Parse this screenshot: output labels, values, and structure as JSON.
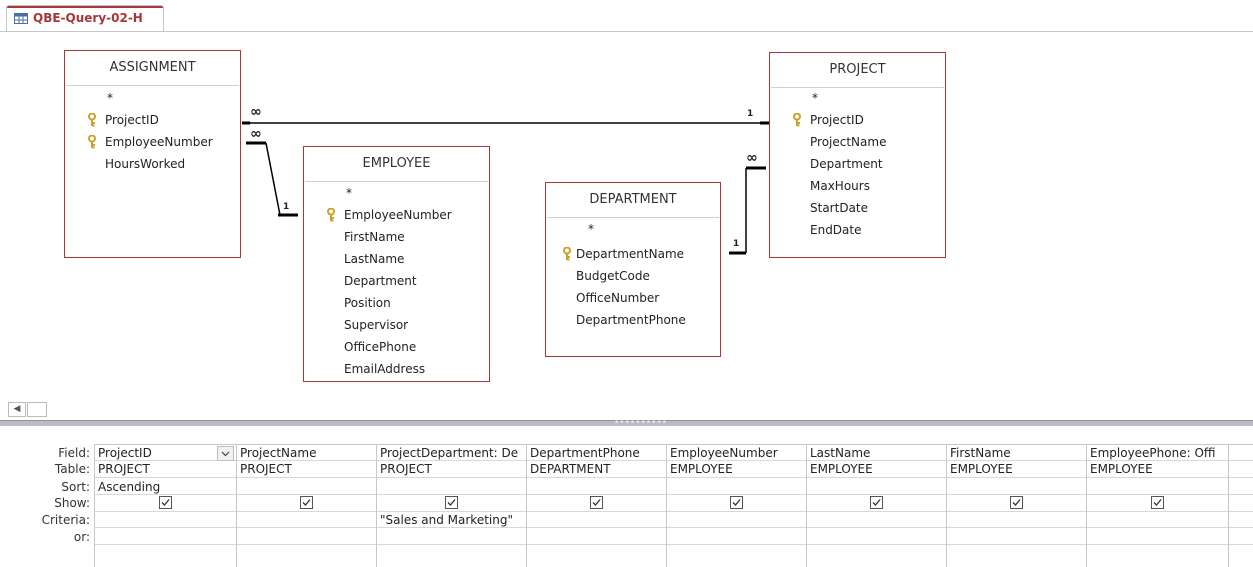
{
  "tab": {
    "label": "QBE-Query-02-H",
    "icon": "query-icon"
  },
  "tables": {
    "assignment": {
      "title": "ASSIGNMENT",
      "fields": [
        "*",
        "ProjectID",
        "EmployeeNumber",
        "HoursWorked"
      ],
      "keys": [
        1,
        2
      ]
    },
    "employee": {
      "title": "EMPLOYEE",
      "fields": [
        "*",
        "EmployeeNumber",
        "FirstName",
        "LastName",
        "Department",
        "Position",
        "Supervisor",
        "OfficePhone",
        "EmailAddress"
      ],
      "keys": [
        1
      ]
    },
    "department": {
      "title": "DEPARTMENT",
      "fields": [
        "*",
        "DepartmentName",
        "BudgetCode",
        "OfficeNumber",
        "DepartmentPhone"
      ],
      "keys": [
        1
      ]
    },
    "project": {
      "title": "PROJECT",
      "fields": [
        "*",
        "ProjectID",
        "ProjectName",
        "Department",
        "MaxHours",
        "StartDate",
        "EndDate"
      ],
      "keys": [
        1
      ]
    }
  },
  "relationships": {
    "many_symbol": "∞",
    "one_symbol": "1"
  },
  "grid": {
    "row_labels": [
      "Field:",
      "Table:",
      "Sort:",
      "Show:",
      "Criteria:",
      "or:"
    ],
    "columns": [
      {
        "field": "ProjectID",
        "table": "PROJECT",
        "sort": "Ascending",
        "show": true,
        "criteria": "",
        "dropdown": true
      },
      {
        "field": "ProjectName",
        "table": "PROJECT",
        "sort": "",
        "show": true,
        "criteria": ""
      },
      {
        "field": "ProjectDepartment: De",
        "table": "PROJECT",
        "sort": "",
        "show": true,
        "criteria": "\"Sales and Marketing\""
      },
      {
        "field": "DepartmentPhone",
        "table": "DEPARTMENT",
        "sort": "",
        "show": true,
        "criteria": ""
      },
      {
        "field": "EmployeeNumber",
        "table": "EMPLOYEE",
        "sort": "",
        "show": true,
        "criteria": ""
      },
      {
        "field": "LastName",
        "table": "EMPLOYEE",
        "sort": "",
        "show": true,
        "criteria": ""
      },
      {
        "field": "FirstName",
        "table": "EMPLOYEE",
        "sort": "",
        "show": true,
        "criteria": ""
      },
      {
        "field": "EmployeePhone: Offi",
        "table": "EMPLOYEE",
        "sort": "",
        "show": true,
        "criteria": ""
      }
    ]
  },
  "colors": {
    "accent": "#a4373a",
    "key_icon": "#c9a227"
  }
}
